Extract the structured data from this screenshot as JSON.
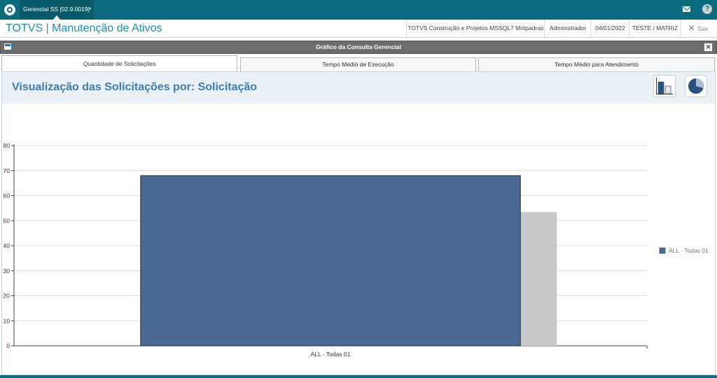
{
  "topbar": {
    "app_tab_label": "Gerencial SS [02.9.0019]",
    "close_glyph": "×",
    "help_glyph": "?"
  },
  "header": {
    "app_title": "TOTVS | Manutenção de Ativos",
    "environment": "TOTVS Construção e Projetos MSSQL7 Mntpadrao",
    "user": "Administrador",
    "date": "04/01/2022",
    "company": "TESTE / MATRIZ",
    "exit_glyph": "✕",
    "exit_label": "Sair"
  },
  "panel": {
    "title": "Gráfico da Consulta Gerencial",
    "close_glyph": "✕"
  },
  "tabs": [
    {
      "label": "Quantidade de Solicitações"
    },
    {
      "label": "Tempo Médio de Execução"
    },
    {
      "label": "Tempo Médio para Atendimento"
    }
  ],
  "view": {
    "heading": "Visualização das Solicitações por: Solicitação"
  },
  "colors": {
    "accent": "#0c6a7e",
    "bar": "#4a6a94",
    "bar_shadow": "#c8c8c8",
    "heading": "#3c7ab2"
  },
  "icons": {
    "bar_chart_button": "bar-chart-icon",
    "pie_chart_button": "pie-chart-icon"
  },
  "chart_data": {
    "type": "bar",
    "categories": [
      "ALL - Todas 01"
    ],
    "series": [
      {
        "name": "ALL - Todas 01",
        "values": [
          68
        ]
      }
    ],
    "ylim": [
      0,
      80
    ],
    "yticks": [
      0,
      10,
      20,
      30,
      40,
      50,
      60,
      70,
      80
    ],
    "grid": true,
    "legend": "right",
    "title": "",
    "xlabel": "",
    "ylabel": ""
  }
}
